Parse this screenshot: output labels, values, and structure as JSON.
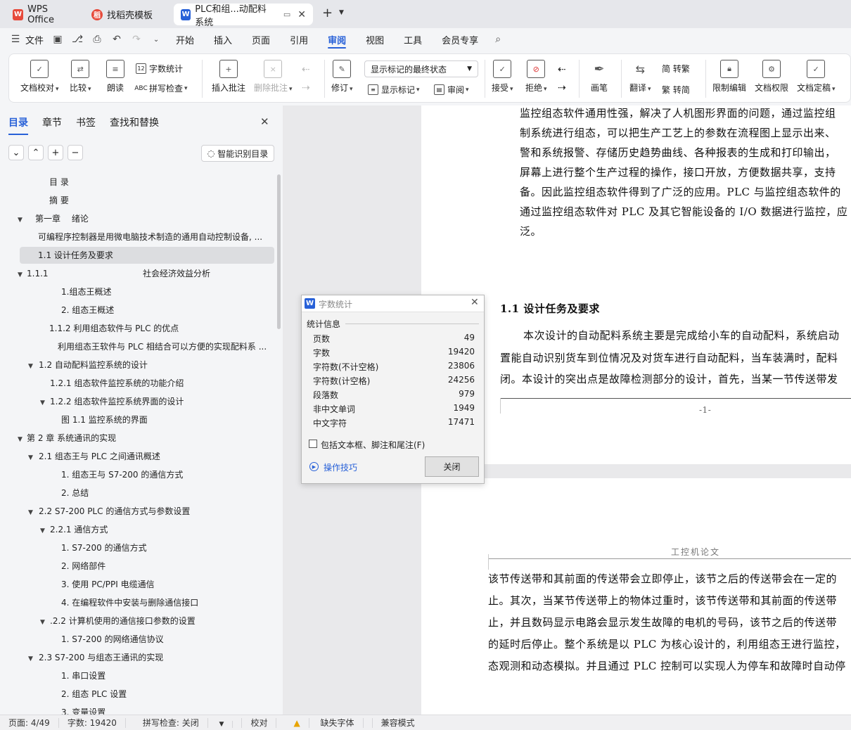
{
  "tabs": {
    "wps": "WPS Office",
    "templates": "找稻壳模板",
    "doc": "PLC和组...动配料系统"
  },
  "menu": {
    "file": "文件",
    "items": [
      "开始",
      "插入",
      "页面",
      "引用",
      "审阅",
      "视图",
      "工具",
      "会员专享"
    ],
    "active": "审阅"
  },
  "ribbon": {
    "doc_check": "文档校对",
    "compare": "比较",
    "read": "朗读",
    "word_count": "字数统计",
    "spell_check": "拼写检查",
    "insert_comment": "插入批注",
    "delete_comment": "删除批注",
    "revise": "修订",
    "show_mode": "显示标记的最终状态",
    "show_marks": "显示标记",
    "review": "审阅",
    "accept": "接受",
    "reject": "拒绝",
    "pen": "画笔",
    "translate": "翻译",
    "to_trad": "简 转繁",
    "to_simp": "繁 转简",
    "restrict": "限制编辑",
    "permission": "文档权限",
    "finalize": "文档定稿"
  },
  "nav": {
    "tabs": [
      "目录",
      "章节",
      "书签",
      "查找和替换"
    ],
    "smart": "智能识别目录",
    "toc": [
      "目 录",
      "摘 要",
      "第一章　 绪论",
      "可编程序控制器是用微电脑技术制造的通用自动控制设备, ...",
      "1.1 设计任务及要求",
      "1.1.1",
      "社会经济效益分析",
      "1.组态王概述",
      "2. 组态王概述",
      "1.1.2 利用组态软件与 PLC 的优点",
      "利用组态王软件与 PLC 相结合可以方便的实现配料系 ...",
      "1.2 自动配料监控系统的设计",
      "1.2.1 组态软件监控系统的功能介绍",
      "1.2.2 组态软件监控系统界面的设计",
      "图 1.1 监控系统的界面",
      "第 2 章 系统通讯的实现",
      "2.1 组态王与 PLC 之间通讯概述",
      "1. 组态王与 S7-200 的通信方式",
      "2. 总结",
      "2.2 S7-200 PLC 的通信方式与参数设置",
      "2.2.1 通信方式",
      "1. S7-200 的通信方式",
      "2. 网络部件",
      "3. 使用 PC/PPI 电缆通信",
      "4. 在编程软件中安装与删除通信接口",
      ".2.2 计算机使用的通信接口参数的设置",
      "1. S7-200 的网络通信协议",
      "2.3 S7-200 与组态王通讯的实现",
      "1. 串口设置",
      "2. 组态 PLC 设置",
      "3. 变量设置"
    ]
  },
  "doc": {
    "p1": [
      "监控组态软件通用性强，解决了人机图形界面的问题，通过监控组",
      "制系统进行组态，可以把生产工艺上的参数在流程图上显示出来、",
      "警和系统报警、存储历史趋势曲线、各种报表的生成和打印输出，",
      "屏幕上进行整个生产过程的操作，接口开放，方便数据共享，支持",
      "备。因此监控组态软件得到了广泛的应用。PLC 与监控组态软件的",
      "通过监控组态软件对 PLC 及其它智能设备的 I/O 数据进行监控，应",
      "泛。"
    ],
    "heading": "1.1 设计任务及要求",
    "p2": [
      "本次设计的自动配料系统主要是完成给小车的自动配料，系统启动",
      "置能自动识别货车到位情况及对货车进行自动配料，当车装满时，配料",
      "闭。本设计的突出点是故障检测部分的设计，首先，当某一节传送带发"
    ],
    "page_num": "-1-",
    "header": "工控机论文",
    "p3": [
      "该节传送带和其前面的传送带会立即停止，该节之后的传送带会在一定的",
      "止。其次，当某节传送带上的物体过重时，该节传送带和其前面的传送带",
      "止，并且数码显示电路会显示发生故障的电机的号码，该节之后的传送带",
      "的延时后停止。整个系统是以 PLC 为核心设计的，利用组态王进行监控，",
      "态观测和动态模拟。并且通过 PLC 控制可以实现人为停车和故障时自动停"
    ]
  },
  "dialog": {
    "title": "字数统计",
    "section": "统计信息",
    "stats": [
      [
        "页数",
        "49"
      ],
      [
        "字数",
        "19420"
      ],
      [
        "字符数(不计空格)",
        "23806"
      ],
      [
        "字符数(计空格)",
        "24256"
      ],
      [
        "段落数",
        "979"
      ],
      [
        "非中文单词",
        "1949"
      ],
      [
        "中文字符",
        "17471"
      ]
    ],
    "checkbox": "包括文本框、脚注和尾注(F)",
    "tips": "操作技巧",
    "close": "关闭"
  },
  "status": {
    "page": "页面: 4/49",
    "words": "字数: 19420",
    "spell": "拼写检查: 关闭",
    "proof": "校对",
    "missing_font": "缺失字体",
    "compat": "兼容模式"
  },
  "colors": {
    "accent": "#2861d8",
    "wps_red": "#e64a3b"
  }
}
